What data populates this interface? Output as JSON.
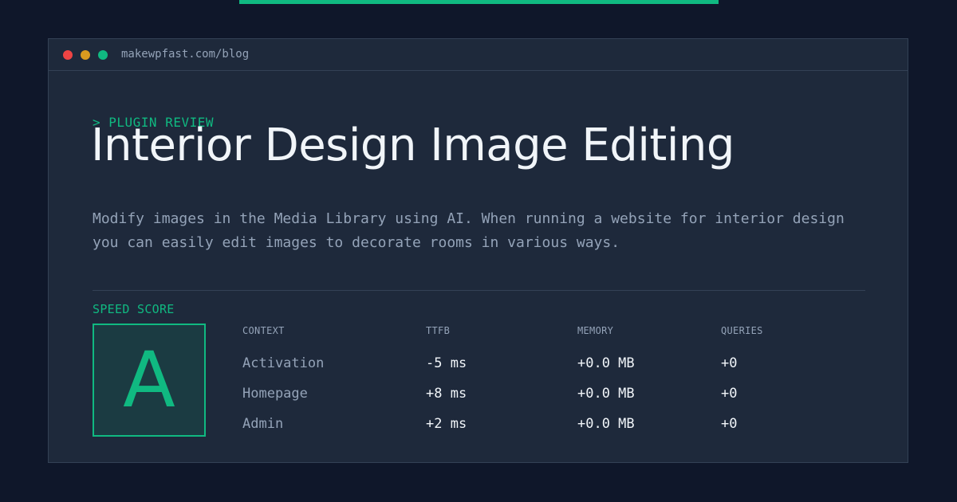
{
  "colors": {
    "accent": "#10b981",
    "background": "#0f172a",
    "card": "#1e293b",
    "border": "#334155",
    "muted_text": "#94a3b8",
    "primary_text": "#f1f5f9",
    "dot_red": "#ef4444",
    "dot_yellow": "#d99a1f",
    "dot_green": "#10b981"
  },
  "window": {
    "url": "makewpfast.com/blog"
  },
  "article": {
    "kicker": "> PLUGIN REVIEW",
    "title": "Interior Design Image Editing",
    "description": "Modify images in the Media Library using AI. When running a website for interior design you can easily edit images to decorate rooms in various ways."
  },
  "speed": {
    "label": "SPEED SCORE",
    "grade": "A",
    "columns": [
      "CONTEXT",
      "TTFB",
      "MEMORY",
      "QUERIES"
    ],
    "rows": [
      {
        "context": "Activation",
        "ttfb": "-5 ms",
        "memory": "+0.0 MB",
        "queries": "+0"
      },
      {
        "context": "Homepage",
        "ttfb": "+8 ms",
        "memory": "+0.0 MB",
        "queries": "+0"
      },
      {
        "context": "Admin",
        "ttfb": "+2 ms",
        "memory": "+0.0 MB",
        "queries": "+0"
      }
    ]
  }
}
